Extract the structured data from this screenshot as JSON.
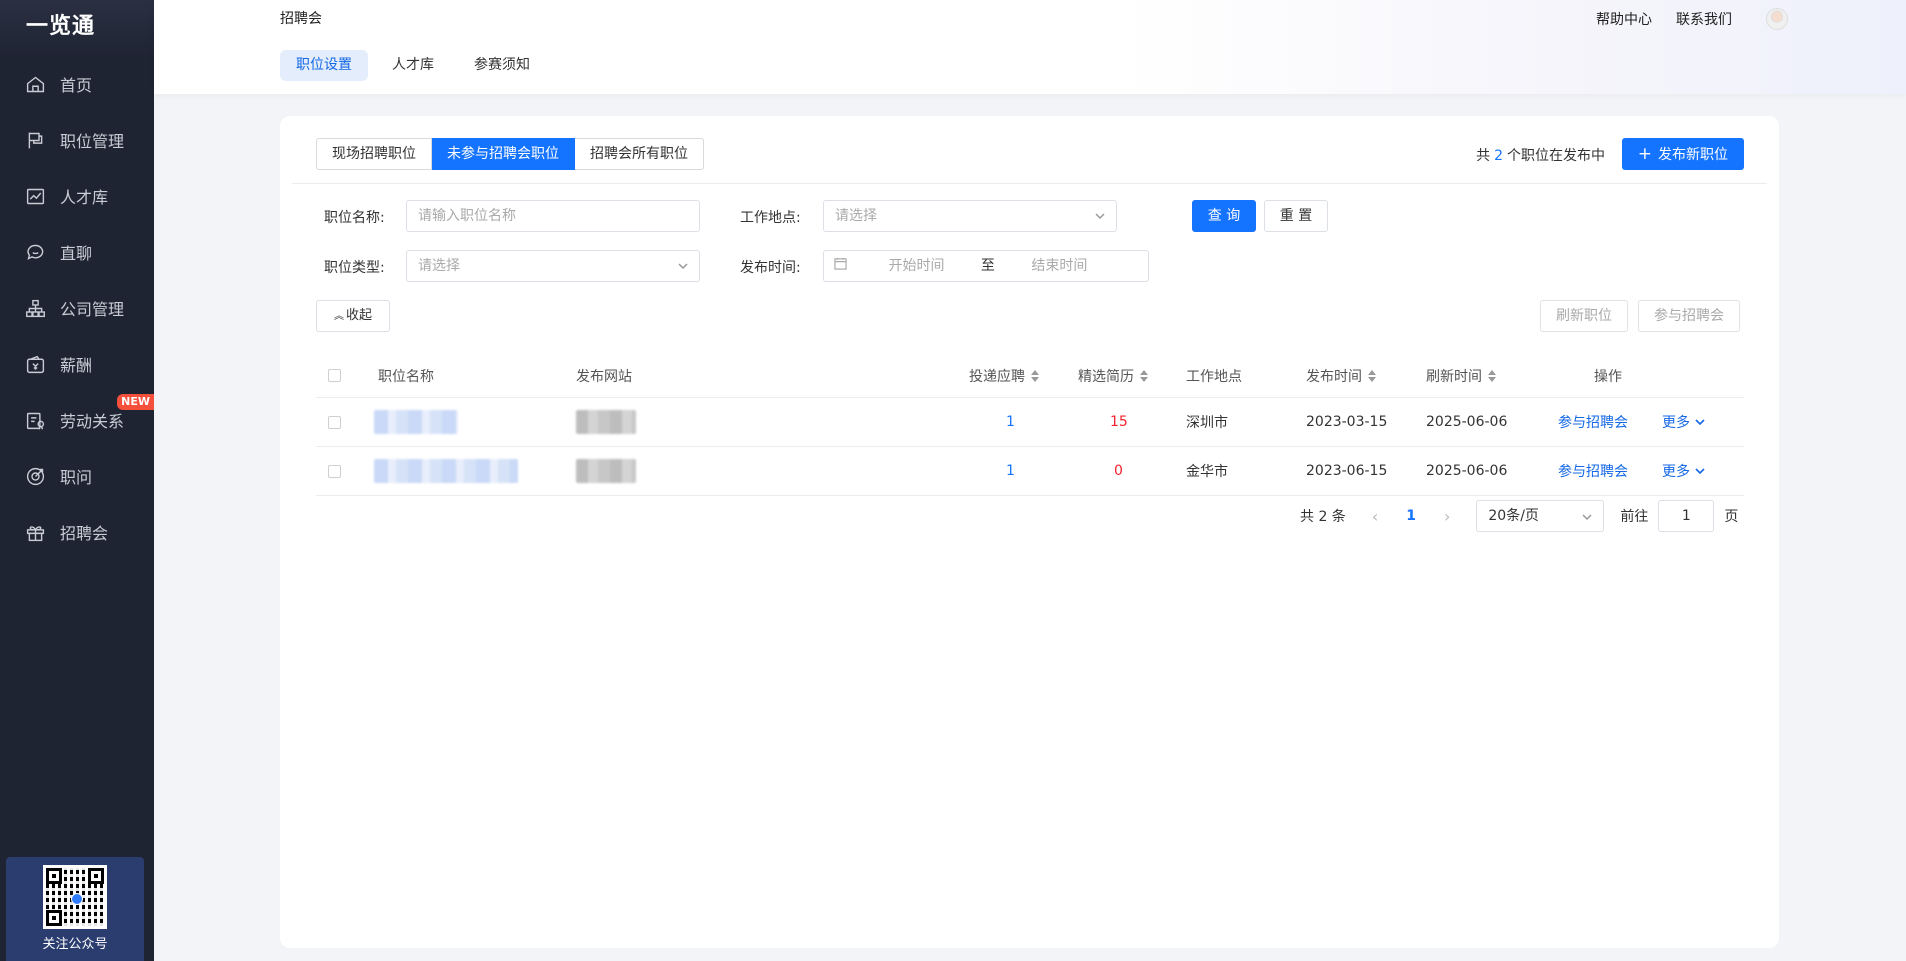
{
  "app": {
    "logo": "一览通"
  },
  "sidebar": {
    "items": [
      {
        "label": "首页",
        "icon": "home-icon"
      },
      {
        "label": "职位管理",
        "icon": "flag-icon"
      },
      {
        "label": "人才库",
        "icon": "chart-line-icon"
      },
      {
        "label": "直聊",
        "icon": "chat-icon"
      },
      {
        "label": "公司管理",
        "icon": "org-chart-icon"
      },
      {
        "label": "薪酬",
        "icon": "wallet-icon"
      },
      {
        "label": "劳动关系",
        "icon": "contract-icon",
        "badge": "NEW"
      },
      {
        "label": "职问",
        "icon": "target-icon"
      },
      {
        "label": "招聘会",
        "icon": "gift-icon"
      }
    ],
    "qr_label": "关注公众号"
  },
  "header": {
    "breadcrumb": "招聘会",
    "help": "帮助中心",
    "contact": "联系我们",
    "tabs": [
      {
        "label": "职位设置",
        "active": true
      },
      {
        "label": "人才库",
        "active": false
      },
      {
        "label": "参赛须知",
        "active": false
      }
    ]
  },
  "toolbar": {
    "segments": [
      {
        "label": "现场招聘职位",
        "active": false
      },
      {
        "label": "未参与招聘会职位",
        "active": true
      },
      {
        "label": "招聘会所有职位",
        "active": false
      }
    ],
    "count_prefix": "共",
    "count": "2",
    "count_suffix": "个职位在发布中",
    "publish_button": "发布新职位"
  },
  "filters": {
    "job_name_label": "职位名称:",
    "job_name_placeholder": "请输入职位名称",
    "location_label": "工作地点:",
    "location_placeholder": "请选择",
    "job_type_label": "职位类型:",
    "job_type_placeholder": "请选择",
    "publish_time_label": "发布时间:",
    "start_placeholder": "开始时间",
    "to": "至",
    "end_placeholder": "结束时间",
    "query_button": "查 询",
    "reset_button": "重 置",
    "collapse_button": "收起"
  },
  "actions": {
    "refresh": "刷新职位",
    "join": "参与招聘会"
  },
  "table": {
    "columns": [
      "职位名称",
      "发布网站",
      "投递应聘",
      "精选简历",
      "工作地点",
      "发布时间",
      "刷新时间",
      "操作"
    ],
    "rows": [
      {
        "applications": "1",
        "resumes": "15",
        "location": "深圳市",
        "publish_date": "2023-03-15",
        "refresh_date": "2025-06-06",
        "action": "参与招聘会",
        "more": "更多"
      },
      {
        "applications": "1",
        "resumes": "0",
        "location": "金华市",
        "publish_date": "2023-06-15",
        "refresh_date": "2025-06-06",
        "action": "参与招聘会",
        "more": "更多"
      }
    ]
  },
  "pagination": {
    "total": "共 2 条",
    "current": "1",
    "page_size": "20条/页",
    "goto_label": "前往",
    "goto_value": "1",
    "page_unit": "页"
  },
  "colors": {
    "primary": "#1473ff",
    "danger": "#f5222d",
    "sidebar_bg": "#1f2433"
  }
}
